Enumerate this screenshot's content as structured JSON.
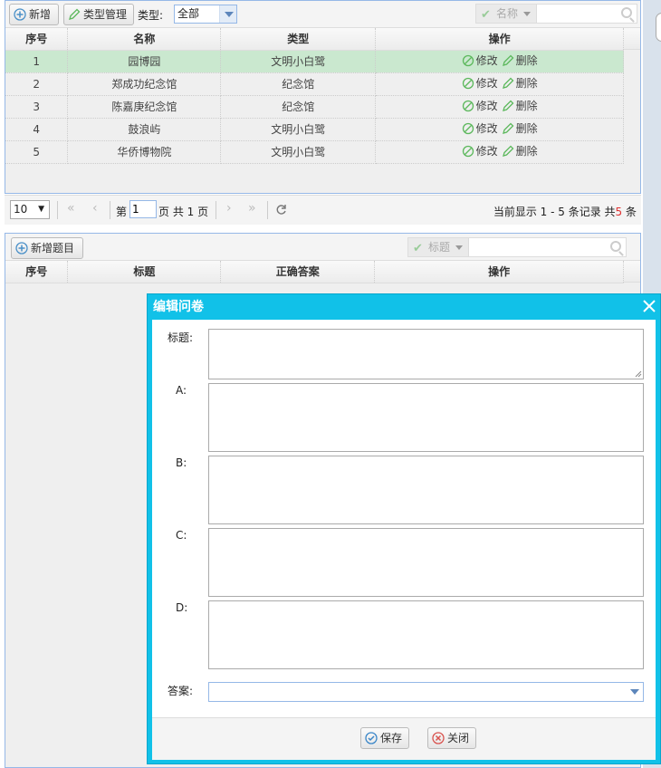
{
  "toolbar": {
    "add_label": "新增",
    "type_manage_label": "类型管理",
    "type_filter_label": "类型:",
    "type_filter_value": "全部",
    "search_field": "名称"
  },
  "grid1": {
    "headers": [
      "序号",
      "名称",
      "类型",
      "操作"
    ],
    "rows": [
      {
        "no": "1",
        "name": "园博园",
        "type": "文明小白鹭"
      },
      {
        "no": "2",
        "name": "郑成功纪念馆",
        "type": "纪念馆"
      },
      {
        "no": "3",
        "name": "陈嘉庚纪念馆",
        "type": "纪念馆"
      },
      {
        "no": "4",
        "name": "鼓浪屿",
        "type": "文明小白鹭"
      },
      {
        "no": "5",
        "name": "华侨博物院",
        "type": "文明小白鹭"
      }
    ],
    "edit_label": "修改",
    "delete_label": "删除"
  },
  "pager": {
    "page_size": "10",
    "page_prefix": "第",
    "page_value": "1",
    "page_suffix": "页 共 1 页",
    "summary_prefix": "当前显示 1 - 5 条记录 共",
    "summary_total": "5",
    "summary_suffix": " 条"
  },
  "panel2": {
    "add_question_label": "新增题目",
    "search_field": "标题",
    "headers": [
      "序号",
      "标题",
      "正确答案",
      "操作"
    ]
  },
  "dialog": {
    "title": "编辑问卷",
    "field_title": "标题:",
    "field_a": "A:",
    "field_b": "B:",
    "field_c": "C:",
    "field_d": "D:",
    "field_answer": "答案:",
    "save_label": "保存",
    "close_label": "关闭"
  },
  "colors": {
    "accent": "#11c1e8",
    "highlight_row": "#cae8cf",
    "total_red": "#e03030"
  }
}
